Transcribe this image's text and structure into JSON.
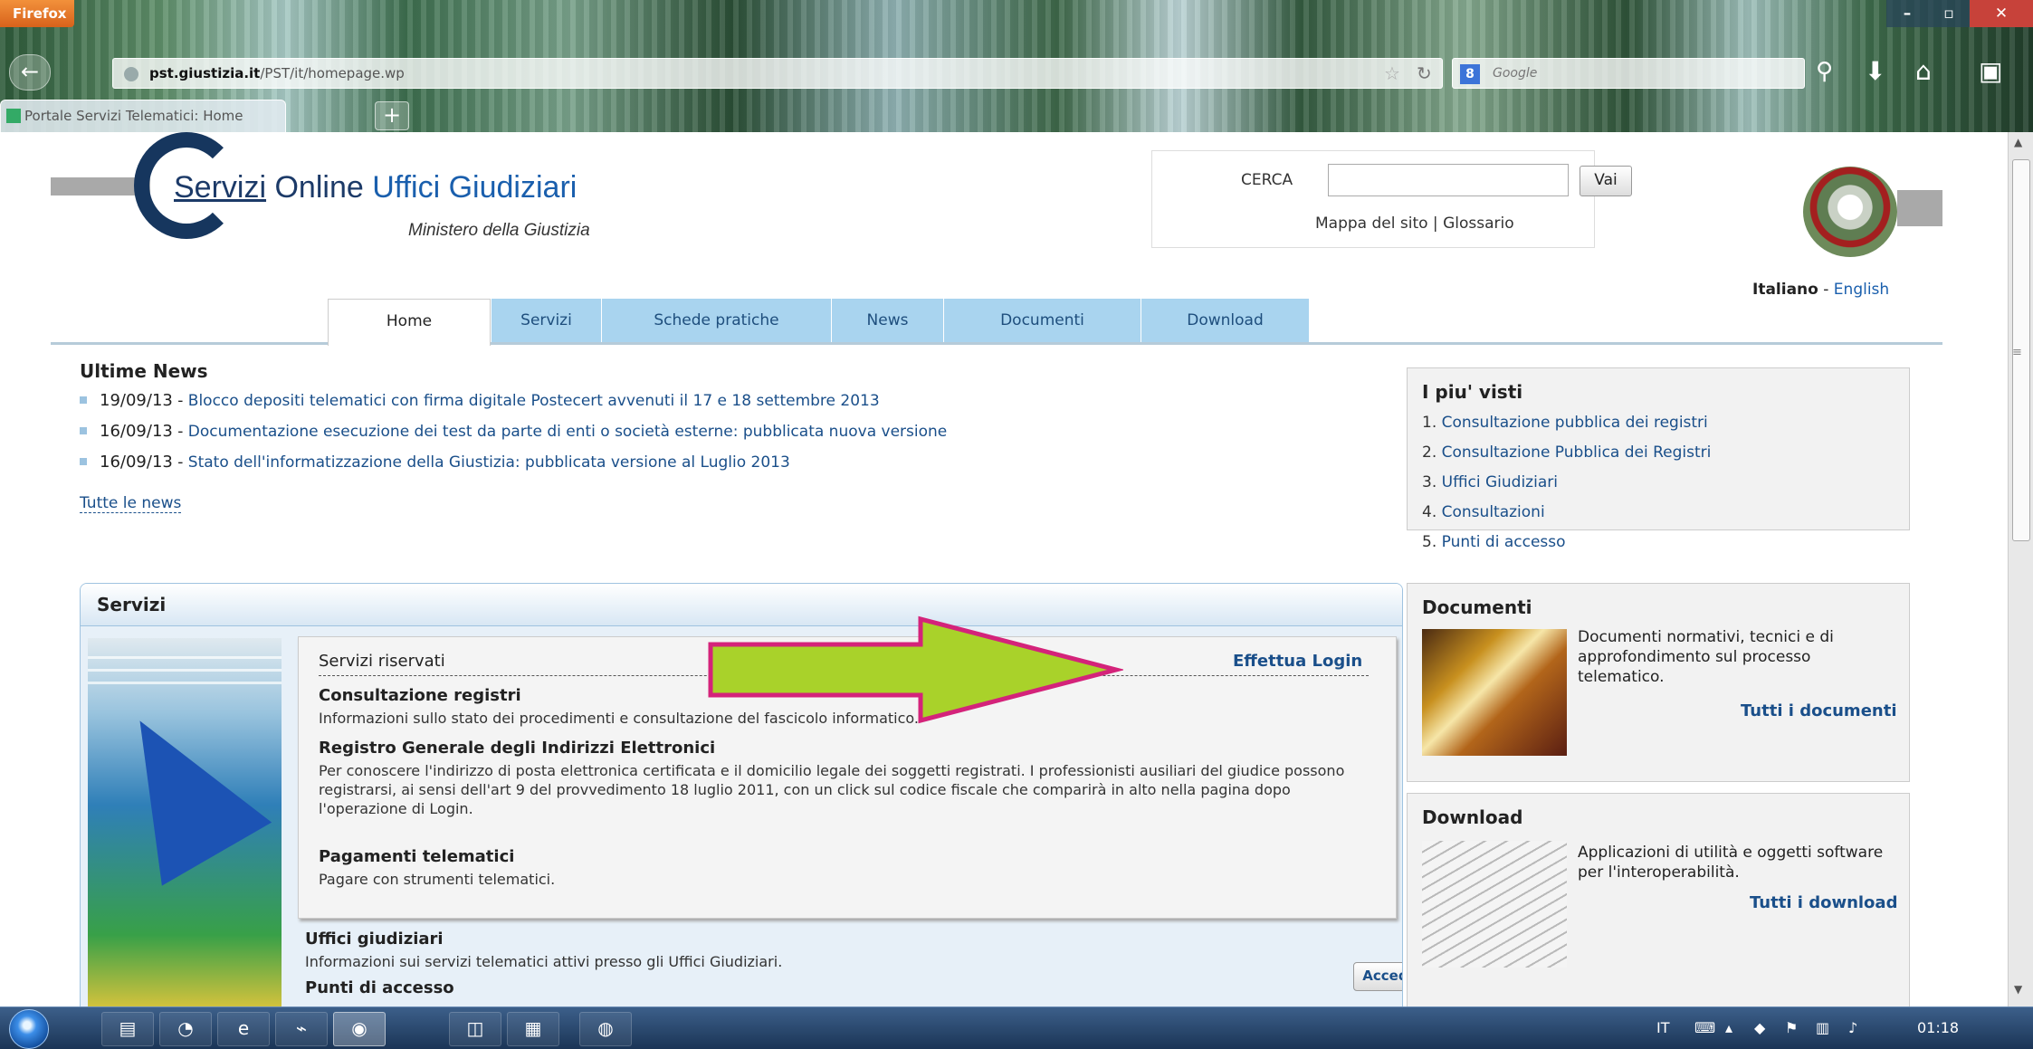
{
  "browser": {
    "menu_label": "Firefox",
    "url_host": "pst.giustizia.it",
    "url_path": "/PST/it/homepage.wp",
    "url_prefix": "",
    "search_placeholder": "Google",
    "tab_title": "Portale Servizi Telematici: Home",
    "new_tab": "+",
    "back": "←",
    "min": "–",
    "max": "▫",
    "close": "✕"
  },
  "header": {
    "logo_part1": "Servizi",
    "logo_part2": " Online ",
    "logo_part3": "Uffici Giudiziari",
    "subtitle": "Ministero della Giustizia",
    "search_label": "CERCA",
    "search_value": "",
    "search_button": "Vai",
    "sitemap_link": "Mappa del sito",
    "links_sep": " | ",
    "glossary_link": "Glossario",
    "lang_current": "Italiano",
    "lang_sep": " - ",
    "lang_other": "English"
  },
  "nav": {
    "tabs": [
      "Home",
      "Servizi",
      "Schede pratiche",
      "News",
      "Documenti",
      "Download"
    ],
    "active": "Home"
  },
  "news": {
    "heading": "Ultime News",
    "items": [
      {
        "date": "19/09/13",
        "text": "Blocco depositi telematici con firma digitale Postecert avvenuti il 17 e 18 settembre 2013"
      },
      {
        "date": "16/09/13",
        "text": "Documentazione esecuzione dei test da parte di enti o società esterne: pubblicata nuova versione"
      },
      {
        "date": "16/09/13",
        "text": "Stato dell'informatizzazione della Giustizia: pubblicata versione al Luglio 2013"
      }
    ],
    "all_link": "Tutte le news"
  },
  "servizi": {
    "heading": "Servizi",
    "reserved_title": "Servizi riservati",
    "login_link": "Effettua Login",
    "services": [
      {
        "title": "Consultazione registri",
        "desc": "Informazioni sullo stato dei procedimenti e consultazione del fascicolo informatico."
      },
      {
        "title": "Registro Generale degli Indirizzi Elettronici",
        "desc": "Per conoscere l'indirizzo di posta elettronica certificata e il domicilio legale dei soggetti registrati. I professionisti ausiliari del giudice possono registrarsi, ai sensi dell'art 9 del provvedimento 18 luglio 2011, con un click sul codice fiscale che comparirà in alto nella pagina dopo l'operazione di Login."
      },
      {
        "title": "Pagamenti telematici",
        "desc": "Pagare con strumenti telematici."
      }
    ],
    "uffici_title": "Uffici giudiziari",
    "uffici_desc": "Informazioni sui servizi telematici attivi presso gli Uffici Giudiziari.",
    "uffici_button": "Accedi",
    "punti_title": "Punti di accesso"
  },
  "sidebar": {
    "visti_heading": "I piu' visti",
    "visti": [
      {
        "num": "1.",
        "label": "Consultazione pubblica dei registri"
      },
      {
        "num": "2.",
        "label": "Consultazione Pubblica dei Registri"
      },
      {
        "num": "3.",
        "label": "Uffici Giudiziari"
      },
      {
        "num": "4.",
        "label": "Consultazioni"
      },
      {
        "num": "5.",
        "label": "Punti di accesso"
      }
    ],
    "documenti_heading": "Documenti",
    "documenti_desc": "Documenti normativi, tecnici e di approfondimento sul processo telematico.",
    "documenti_link": "Tutti i documenti",
    "download_heading": "Download",
    "download_desc": "Applicazioni di utilità e oggetti software per l'interoperabilità.",
    "download_link": "Tutti i download"
  },
  "taskbar": {
    "lang": "IT",
    "clock": "01:18"
  },
  "colors": {
    "accent": "#1a4f8a",
    "nav_tab": "#a9d4ef",
    "arrow_fill": "#a9d22a",
    "arrow_stroke": "#d4237a"
  }
}
